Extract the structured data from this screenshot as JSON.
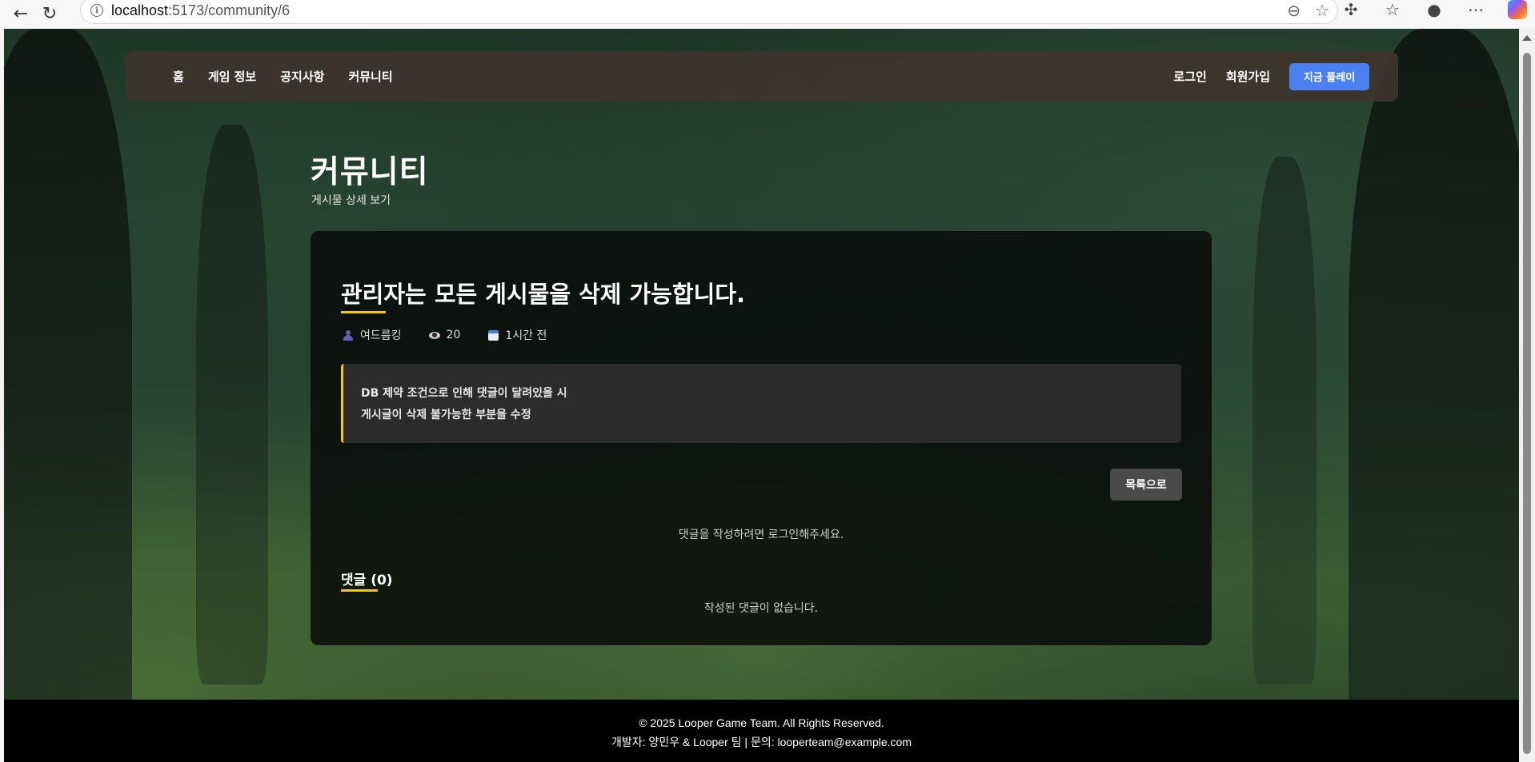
{
  "browser": {
    "url_host": "localhost",
    "url_path": ":5173/community/6",
    "back_icon": "arrow-left-icon",
    "reload_icon": "reload-icon",
    "info_icon": "info-icon",
    "zoom_icon": "zoom-out-icon",
    "favorite_icon": "star-icon",
    "extensions_icon": "puzzle-icon",
    "collections_icon": "favorites-list-icon",
    "profile_icon": "profile-icon",
    "menu_icon": "more-icon",
    "copilot_icon": "copilot-icon"
  },
  "nav": {
    "links": [
      "홈",
      "게임 정보",
      "공지사항",
      "커뮤니티"
    ],
    "login": "로그인",
    "signup": "회원가입",
    "play_now": "지금 플레이",
    "play_color": "#4a80f0"
  },
  "hero": {
    "title": "커뮤니티",
    "subtitle": "게시물 상세 보기"
  },
  "post": {
    "title": "관리자는 모든 게시물을 삭제 가능합니다.",
    "author": "여드름킹",
    "views": "20",
    "time": "1시간 전",
    "body_lines": [
      "DB 제약 조건으로 인해 댓글이 달려있을 시",
      "게시글이 삭제 불가능한 부분을 수정"
    ],
    "list_button": "목록으로",
    "login_prompt": "댓글을 작성하려면 로그인해주세요.",
    "comments_heading": "댓글 (0)",
    "no_comments": "작성된 댓글이 없습니다.",
    "accent_color": "#f5c518"
  },
  "footer": {
    "copyright": "© 2025 Looper Game Team. All Rights Reserved.",
    "developer": "개발자: 양민우 & Looper 팀 | 문의: looperteam@example.com"
  }
}
